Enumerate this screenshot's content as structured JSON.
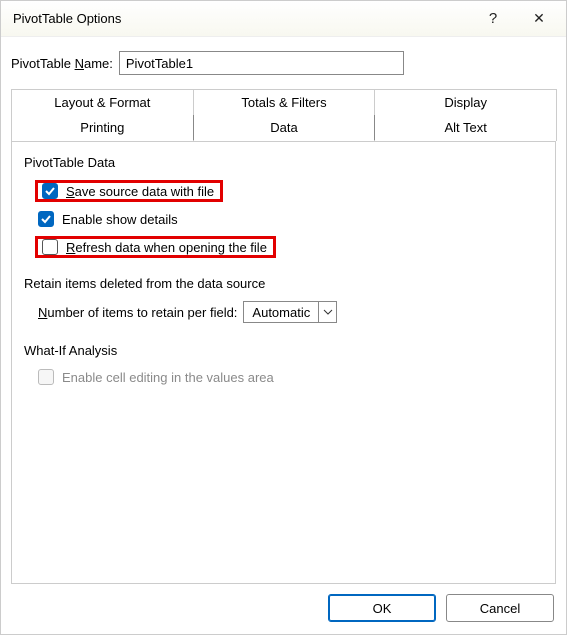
{
  "titlebar": {
    "title": "PivotTable Options",
    "help": "?",
    "close": "✕"
  },
  "name": {
    "label_pre": "PivotTable ",
    "label_u": "N",
    "label_post": "ame:",
    "value": "PivotTable1"
  },
  "tabs": {
    "layout": "Layout & Format",
    "totals": "Totals & Filters",
    "display": "Display",
    "printing": "Printing",
    "data": "Data",
    "alttext": "Alt Text"
  },
  "data_tab": {
    "section1": "PivotTable Data",
    "save_u": "S",
    "save_post": "ave source data with file",
    "enable_show_details": "Enable show details",
    "refresh_u": "R",
    "refresh_post": "efresh data when opening the file",
    "retain_title": "Retain items deleted from the data source",
    "retain_u": "N",
    "retain_post": "umber of items to retain per field:",
    "retain_value": "Automatic",
    "whatif_title": "What-If Analysis",
    "whatif_option": "Enable cell editing in the values area"
  },
  "footer": {
    "ok": "OK",
    "cancel": "Cancel"
  }
}
